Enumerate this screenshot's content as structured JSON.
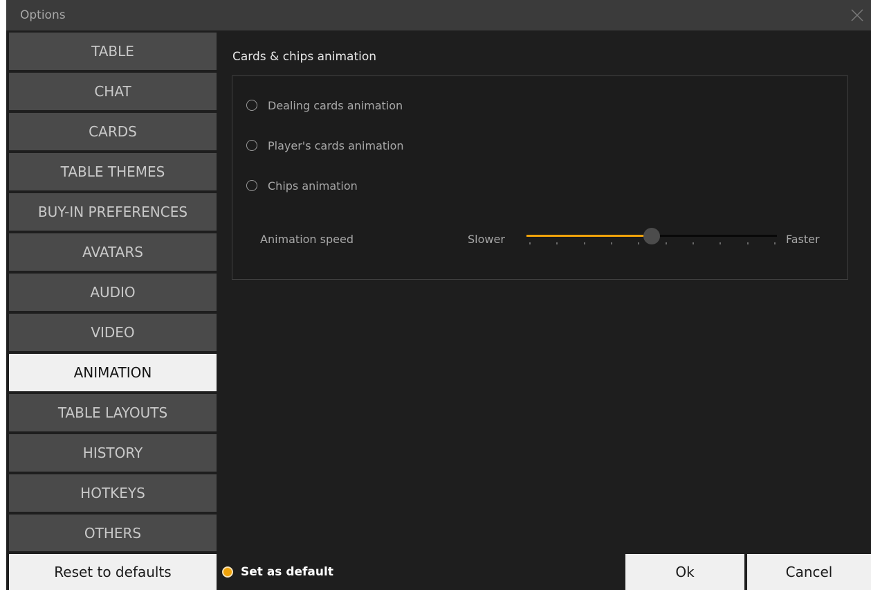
{
  "window": {
    "title": "Options"
  },
  "sidebar": {
    "items": [
      {
        "label": "TABLE",
        "active": false
      },
      {
        "label": "CHAT",
        "active": false
      },
      {
        "label": "CARDS",
        "active": false
      },
      {
        "label": "TABLE THEMES",
        "active": false
      },
      {
        "label": "BUY-IN PREFERENCES",
        "active": false
      },
      {
        "label": "AVATARS",
        "active": false
      },
      {
        "label": "AUDIO",
        "active": false
      },
      {
        "label": "VIDEO",
        "active": false
      },
      {
        "label": "ANIMATION",
        "active": true
      },
      {
        "label": "TABLE LAYOUTS",
        "active": false
      },
      {
        "label": "HISTORY",
        "active": false
      },
      {
        "label": "HOTKEYS",
        "active": false
      },
      {
        "label": "OTHERS",
        "active": false
      }
    ]
  },
  "main": {
    "section_title": "Cards & chips animation",
    "options": [
      {
        "label": "Dealing cards animation",
        "checked": false
      },
      {
        "label": "Player's cards animation",
        "checked": false
      },
      {
        "label": "Chips animation",
        "checked": false
      }
    ],
    "speed": {
      "label": "Animation speed",
      "min_label": "Slower",
      "max_label": "Faster",
      "value_fraction": 0.5,
      "tick_count": 10
    }
  },
  "footer": {
    "reset_label": "Reset to defaults",
    "set_default_label": "Set as default",
    "set_default_checked": true,
    "ok_label": "Ok",
    "cancel_label": "Cancel"
  },
  "colors": {
    "accent": "#f0a30a",
    "background": "#1e1e1e",
    "sidebar_item": "#4a4a4a",
    "active_item": "#f0f0f0"
  }
}
